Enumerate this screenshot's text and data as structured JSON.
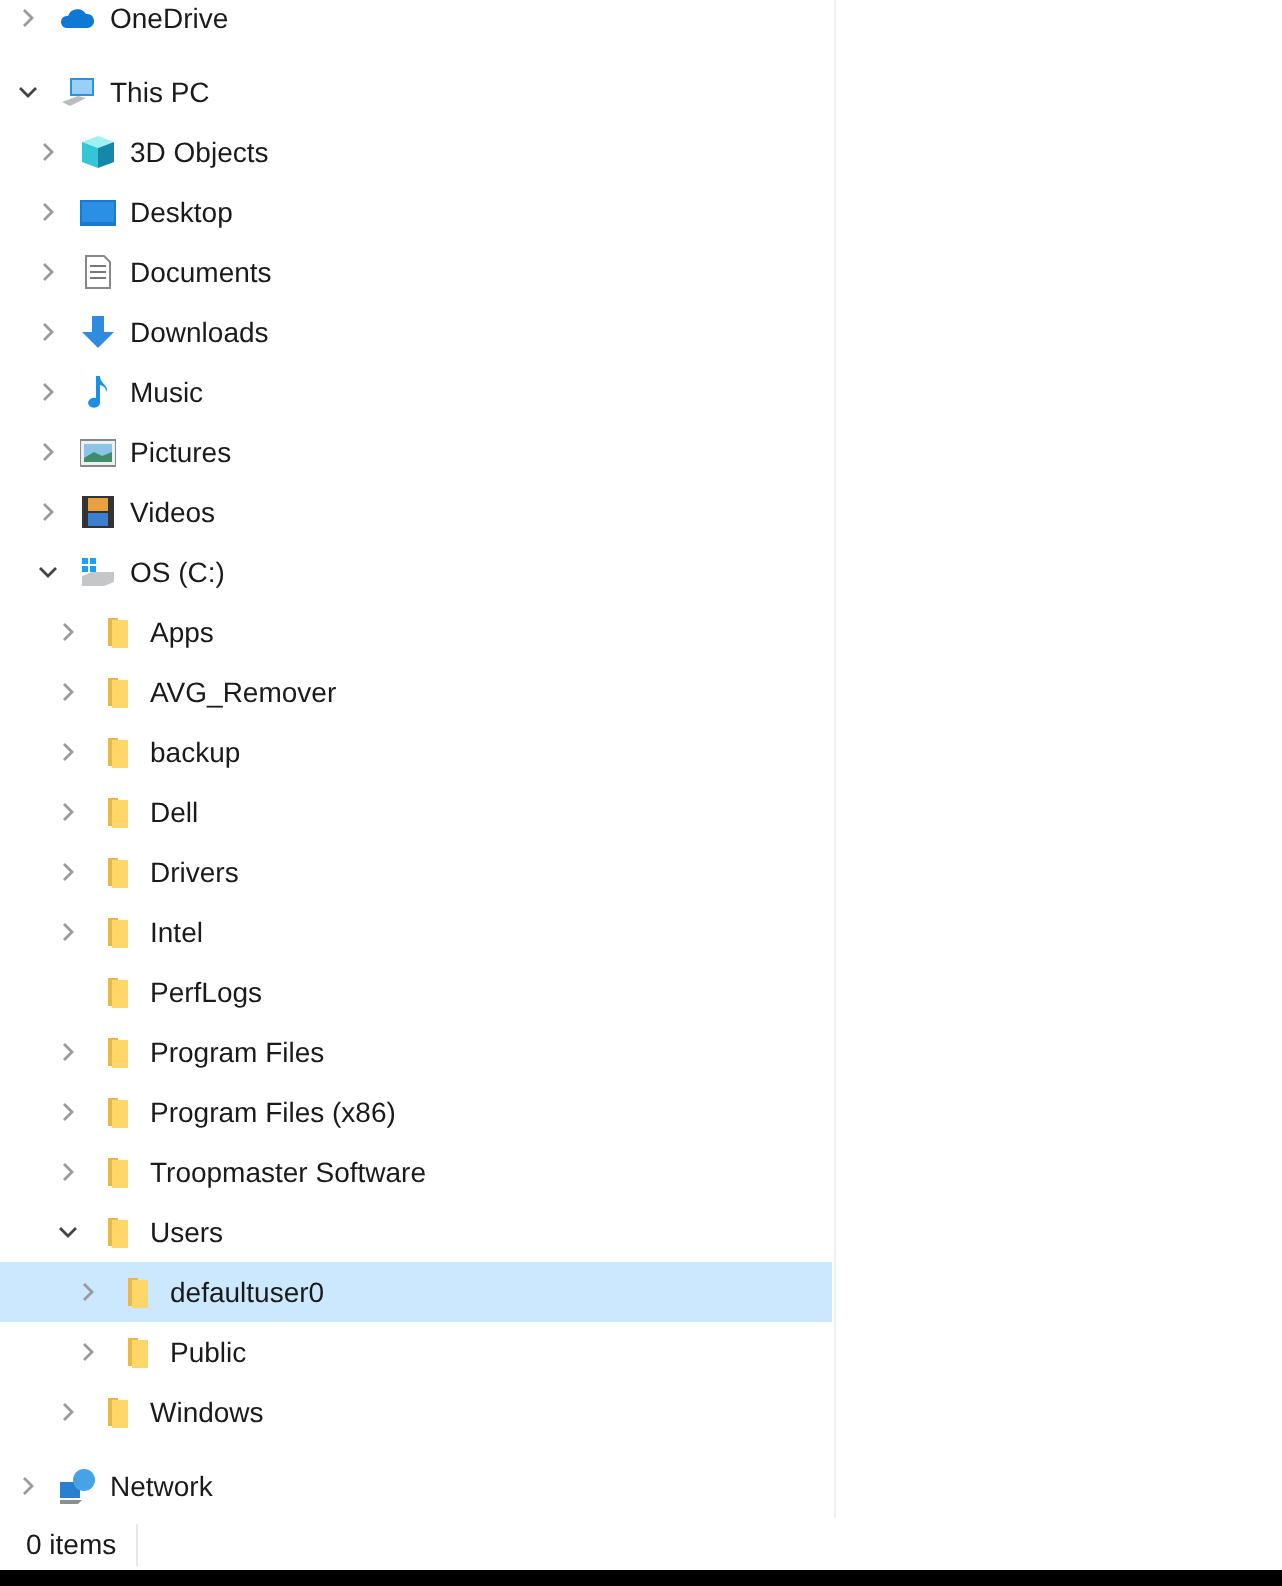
{
  "tree": [
    {
      "label": "OneDrive",
      "kind": "cloud",
      "expandable": true,
      "expanded": false,
      "selected": false
    },
    {
      "label": "This PC",
      "kind": "pc",
      "expandable": true,
      "expanded": true,
      "selected": false,
      "children": [
        {
          "label": "3D Objects",
          "kind": "cube",
          "expandable": true,
          "expanded": false,
          "selected": false
        },
        {
          "label": "Desktop",
          "kind": "desktop",
          "expandable": true,
          "expanded": false,
          "selected": false
        },
        {
          "label": "Documents",
          "kind": "document",
          "expandable": true,
          "expanded": false,
          "selected": false
        },
        {
          "label": "Downloads",
          "kind": "download",
          "expandable": true,
          "expanded": false,
          "selected": false
        },
        {
          "label": "Music",
          "kind": "music",
          "expandable": true,
          "expanded": false,
          "selected": false
        },
        {
          "label": "Pictures",
          "kind": "pictures",
          "expandable": true,
          "expanded": false,
          "selected": false
        },
        {
          "label": "Videos",
          "kind": "videos",
          "expandable": true,
          "expanded": false,
          "selected": false
        },
        {
          "label": "OS (C:)",
          "kind": "drive",
          "expandable": true,
          "expanded": true,
          "selected": false,
          "children": [
            {
              "label": "Apps",
              "kind": "folder",
              "expandable": true,
              "expanded": false,
              "selected": false
            },
            {
              "label": "AVG_Remover",
              "kind": "folder",
              "expandable": true,
              "expanded": false,
              "selected": false
            },
            {
              "label": "backup",
              "kind": "folder",
              "expandable": true,
              "expanded": false,
              "selected": false
            },
            {
              "label": "Dell",
              "kind": "folder",
              "expandable": true,
              "expanded": false,
              "selected": false
            },
            {
              "label": "Drivers",
              "kind": "folder",
              "expandable": true,
              "expanded": false,
              "selected": false
            },
            {
              "label": "Intel",
              "kind": "folder",
              "expandable": true,
              "expanded": false,
              "selected": false
            },
            {
              "label": "PerfLogs",
              "kind": "folder",
              "expandable": false,
              "expanded": false,
              "selected": false
            },
            {
              "label": "Program Files",
              "kind": "folder",
              "expandable": true,
              "expanded": false,
              "selected": false
            },
            {
              "label": "Program Files (x86)",
              "kind": "folder",
              "expandable": true,
              "expanded": false,
              "selected": false
            },
            {
              "label": "Troopmaster Software",
              "kind": "folder",
              "expandable": true,
              "expanded": false,
              "selected": false
            },
            {
              "label": "Users",
              "kind": "folder",
              "expandable": true,
              "expanded": true,
              "selected": false,
              "children": [
                {
                  "label": "defaultuser0",
                  "kind": "folder",
                  "expandable": true,
                  "expanded": false,
                  "selected": true
                },
                {
                  "label": "Public",
                  "kind": "folder",
                  "expandable": true,
                  "expanded": false,
                  "selected": false
                }
              ]
            },
            {
              "label": "Windows",
              "kind": "folder",
              "expandable": true,
              "expanded": false,
              "selected": false
            }
          ]
        }
      ]
    },
    {
      "label": "Network",
      "kind": "network",
      "expandable": true,
      "expanded": false,
      "selected": false
    }
  ],
  "status_bar": {
    "item_count": "0 items"
  }
}
